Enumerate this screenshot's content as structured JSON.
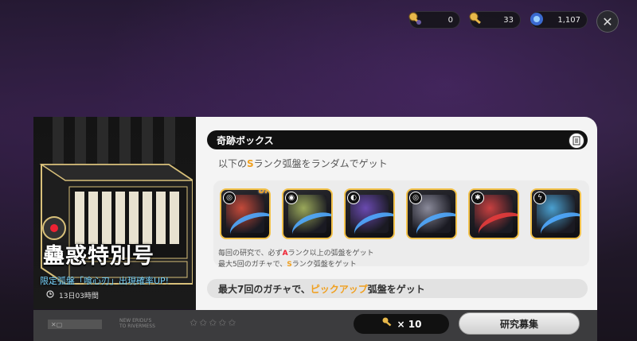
{
  "currencies": [
    {
      "icon": "master-tape-key-icon",
      "value": "0"
    },
    {
      "icon": "encrypted-tape-key-icon",
      "value": "33"
    },
    {
      "icon": "polychrome-icon",
      "value": "1,107"
    }
  ],
  "close_label": "✕",
  "pack": {
    "name": "蠱惑特別号",
    "desc": "限定弧盤「喰心刃」出現確率UP!",
    "time": "13日03時間"
  },
  "box": {
    "title": "奇跡ボックス",
    "subtitle_pre": "以下の",
    "subtitle_rank": "S",
    "subtitle_post": "ランク弧盤をランダムでゲット",
    "up_label": "UP",
    "discs": [
      {
        "badge": "◎",
        "art": "#c44a3a"
      },
      {
        "badge": "◉",
        "art": "#9aa85a"
      },
      {
        "badge": "◐",
        "art": "#6a4ab0"
      },
      {
        "badge": "◎",
        "art": "#8a8a9a"
      },
      {
        "badge": "✱",
        "art": "#c84040"
      },
      {
        "badge": "ϟ",
        "art": "#4aa0d0"
      }
    ],
    "note1_pre": "毎回の研究で、必ず",
    "note1_rank": "A",
    "note1_post": "ランク以上の弧盤をゲット",
    "note2_pre": "最大5回のガチャで、",
    "note2_rank": "S",
    "note2_post": "ランク弧盤をゲット",
    "pickup_pre": "最大7回のガチャで、",
    "pickup_hl": "ピックアップ",
    "pickup_post": "弧盤をゲット"
  },
  "bottom": {
    "left_label": "✕▢",
    "small_text1": "NEW ERIDU'S",
    "small_text2": "TO RIVERMESS",
    "stars": "✩✩✩✩✩",
    "cost": "× 10",
    "recruit_label": "研究募集"
  }
}
